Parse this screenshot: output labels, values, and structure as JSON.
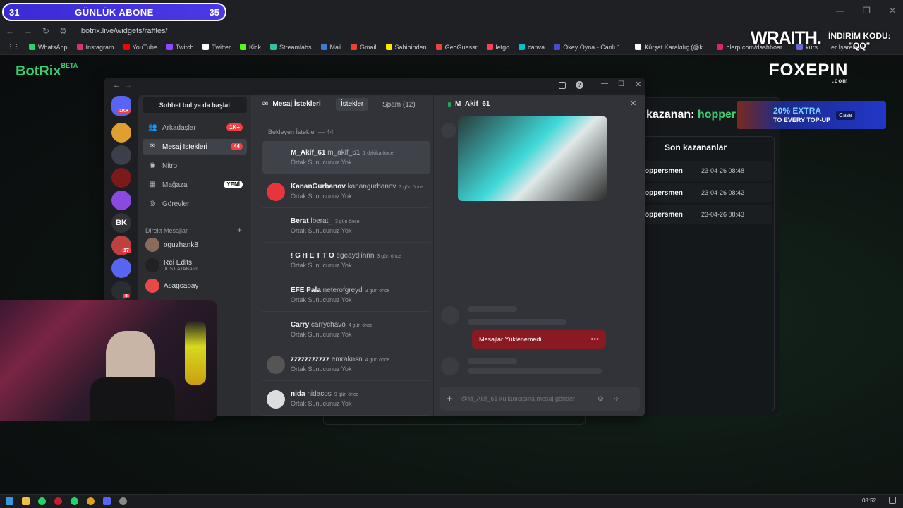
{
  "browser": {
    "url": "botrix.live/widgets/raffles/",
    "bookmarks": [
      {
        "label": "WhatsApp",
        "color": "#25d366"
      },
      {
        "label": "Instagram",
        "color": "#e1306c"
      },
      {
        "label": "YouTube",
        "color": "#ff0000"
      },
      {
        "label": "Twitch",
        "color": "#9146ff"
      },
      {
        "label": "Twitter",
        "color": "#ffffff"
      },
      {
        "label": "Kick",
        "color": "#53fc18"
      },
      {
        "label": "Streamlabs",
        "color": "#31c3a2"
      },
      {
        "label": "Mail",
        "color": "#3a7bd5"
      },
      {
        "label": "Gmail",
        "color": "#ea4335"
      },
      {
        "label": "Sahibinden",
        "color": "#ffe800"
      },
      {
        "label": "GeoGuessr",
        "color": "#e8453c"
      },
      {
        "label": "letgo",
        "color": "#ff3f55"
      },
      {
        "label": "canva",
        "color": "#00c4cc"
      },
      {
        "label": "Okey Oyna - Canlı 1...",
        "color": "#4a4ad0"
      },
      {
        "label": "Kürşat Karakılıç (@k...",
        "color": "#ffffff"
      },
      {
        "label": "blerp.com/dashboar...",
        "color": "#e0245e"
      },
      {
        "label": "kurs",
        "color": "#6b6bd8"
      }
    ],
    "other_bookmarks": "er İşaretleri"
  },
  "overlay": {
    "sub_left": "31",
    "sub_title": "GÜNLÜK ABONE",
    "sub_right": "35",
    "wraith": "WRAITH.",
    "promo_line1": "İNDİRİM KODU:",
    "promo_line2": "\"QQ\"",
    "foxepin": "FOXEPIN",
    "foxepin_com": ".com",
    "case_pct": "20% EXTRA",
    "case_sub": "TO EVERY TOP-UP",
    "case_logo": "Case"
  },
  "botrix": {
    "name": "BotRix",
    "beta": "BETA",
    "winner_label": "kazanan:",
    "winner_name": "hoppers",
    "recent_title": "Son kazananlar",
    "recent": [
      {
        "name": "oppersmen",
        "date": "23-04-26 08:48"
      },
      {
        "name": "oppersmen",
        "date": "23-04-26 08:42"
      },
      {
        "name": "oppersmen",
        "date": "23-04-26 08:43"
      }
    ]
  },
  "discord": {
    "search": "Sohbet bul ya da başlat",
    "nav": [
      {
        "label": "Arkadaşlar",
        "badge": "1K+",
        "icon": "friends-icon"
      },
      {
        "label": "Mesaj İstekleri",
        "badge": "44",
        "icon": "envelope-icon"
      },
      {
        "label": "Nitro",
        "badge": "",
        "icon": "nitro-icon"
      },
      {
        "label": "Mağaza",
        "badge": "YENİ",
        "icon": "shop-icon"
      },
      {
        "label": "Görevler",
        "badge": "",
        "icon": "quests-icon"
      }
    ],
    "dm_header": "Direkt Mesajlar",
    "dms": [
      {
        "name": "oguzhank8",
        "sub": "",
        "color": "#8a6a5a"
      },
      {
        "name": "Rei Edits",
        "sub": "JUST ATABARI",
        "color": "#222"
      },
      {
        "name": "Asagcabay",
        "sub": "",
        "color": "#e84a4a"
      }
    ],
    "guild_labels": {
      "bk": "BK",
      "badge_home": "1K+",
      "badge_17": "17",
      "badge_8": "8"
    },
    "tabs": {
      "header": "Mesaj İstekleri",
      "requests": "İstekler",
      "spam": "Spam (12)"
    },
    "pending_header": "Bekleyen İstekler — 44",
    "requests": [
      {
        "name": "M_Akif_61",
        "user": "m_akif_61",
        "time": "1 dakika önce",
        "sub": "Ortak Sunucunuz Yok",
        "avatar": "none",
        "selected": true
      },
      {
        "name": "KananGurbanov",
        "user": "kanangurbanov",
        "time": "3 gün önce",
        "sub": "Ortak Sunucunuz Yok",
        "avatar": "#e8343c"
      },
      {
        "name": "Berat",
        "user": "lberat_",
        "time": "3 gün önce",
        "sub": "Ortak Sunucunuz Yok",
        "avatar": "none"
      },
      {
        "name": "! G H E T T O",
        "user": "egeaydiinnn",
        "time": "3 gün önce",
        "sub": "Ortak Sunucunuz Yok",
        "avatar": "none"
      },
      {
        "name": "EFE Pala",
        "user": "neterofgreyd",
        "time": "3 gün önce",
        "sub": "Ortak Sunucunuz Yok",
        "avatar": "none"
      },
      {
        "name": "Carry",
        "user": "carrychavo",
        "time": "4 gün önce",
        "sub": "Ortak Sunucunuz Yok",
        "avatar": "none"
      },
      {
        "name": "zzzzzzzzzzz",
        "user": "emraknsn",
        "time": "4 gün önce",
        "sub": "Ortak Sunucunuz Yok",
        "avatar": "#555"
      },
      {
        "name": "nida",
        "user": "nidacos",
        "time": "9 gün önce",
        "sub": "Ortak Sunucunuz Yok",
        "avatar": "#ddd"
      }
    ],
    "chat": {
      "title": "M_Akif_61",
      "error": "Mesajlar Yüklenemedi",
      "placeholder": "@M_Akif_61 kullanıcısına mesaj gönder"
    }
  },
  "taskbar": {
    "time": "08:52"
  }
}
